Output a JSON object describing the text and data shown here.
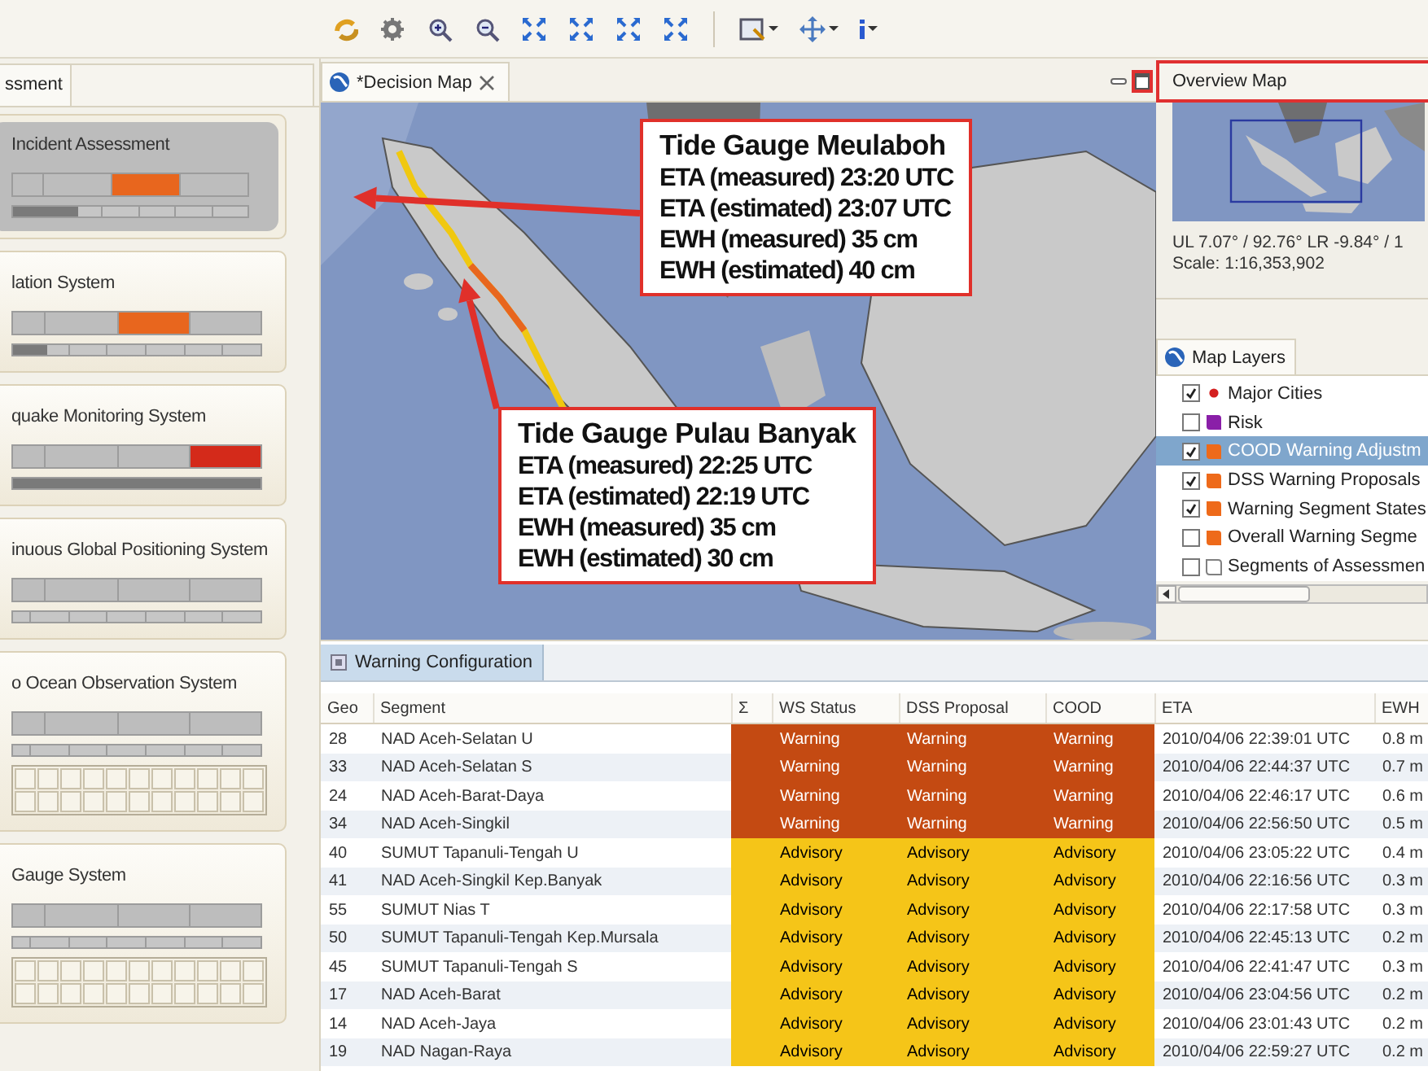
{
  "assessment_panel": {
    "tab": "ssment",
    "systems": [
      {
        "title": "Incident Assessment",
        "selected": true,
        "segments": [
          {
            "color": "#bdbdbd"
          },
          {
            "color": "#bdbdbd"
          },
          {
            "color": "#e8661e"
          },
          {
            "color": "#bdbdbd"
          }
        ],
        "level": 0.28,
        "grid": false
      },
      {
        "title": "lation System",
        "selected": false,
        "segments": [
          {
            "color": "#bdbdbd"
          },
          {
            "color": "#bdbdbd"
          },
          {
            "color": "#e8661e"
          },
          {
            "color": "#bdbdbd"
          }
        ],
        "level": 0.14,
        "grid": false
      },
      {
        "title": "quake Monitoring System",
        "selected": false,
        "segments": [
          {
            "color": "#bdbdbd"
          },
          {
            "color": "#bdbdbd"
          },
          {
            "color": "#bdbdbd"
          },
          {
            "color": "#d42a1a"
          }
        ],
        "level": 1,
        "grid": false
      },
      {
        "title": "inuous Global Positioning System",
        "selected": false,
        "segments": [
          {
            "color": "#bdbdbd"
          },
          {
            "color": "#bdbdbd"
          },
          {
            "color": "#bdbdbd"
          },
          {
            "color": "#bdbdbd"
          }
        ],
        "grid": false
      },
      {
        "title": "o Ocean Observation System",
        "selected": false,
        "segments": [
          {
            "color": "#bdbdbd"
          },
          {
            "color": "#bdbdbd"
          },
          {
            "color": "#bdbdbd"
          },
          {
            "color": "#bdbdbd"
          }
        ],
        "grid": true
      },
      {
        "title": "Gauge System",
        "selected": false,
        "segments": [
          {
            "color": "#bdbdbd"
          },
          {
            "color": "#bdbdbd"
          },
          {
            "color": "#bdbdbd"
          },
          {
            "color": "#bdbdbd"
          }
        ],
        "grid": true
      }
    ]
  },
  "map_view": {
    "tab": "*Decision Map",
    "callouts": [
      {
        "title": "Tide Gauge Meulaboh",
        "lines": [
          "ETA (measured) 23:20 UTC",
          "ETA (estimated) 23:07 UTC",
          "EWH (measured) 35 cm",
          "EWH (estimated) 40 cm"
        ]
      },
      {
        "title": "Tide Gauge Pulau Banyak",
        "lines": [
          "ETA (measured) 22:25 UTC",
          "ETA (estimated) 22:19 UTC",
          "EWH (measured) 35 cm",
          "EWH (estimated) 30 cm"
        ]
      }
    ]
  },
  "overview": {
    "title": "Overview Map",
    "coordinates": "UL 7.07° / 92.76° LR -9.84° / 1",
    "scale": "Scale: 1:16,353,902"
  },
  "layers": {
    "tab": "Map Layers",
    "items": [
      {
        "label": "Major Cities",
        "checked": true,
        "selected": false,
        "kind": "dot",
        "color": "#d42020"
      },
      {
        "label": "Risk",
        "checked": false,
        "selected": false,
        "kind": "fill",
        "color": "#8a1fa8"
      },
      {
        "label": "COOD Warning Adjustm",
        "checked": true,
        "selected": true,
        "kind": "fill",
        "color": "#ee6a1a"
      },
      {
        "label": "DSS Warning Proposals",
        "checked": true,
        "selected": false,
        "kind": "fill",
        "color": "#ee6a1a"
      },
      {
        "label": "Warning Segment States",
        "checked": true,
        "selected": false,
        "kind": "fill",
        "color": "#ee6a1a"
      },
      {
        "label": "Overall Warning Segme",
        "checked": false,
        "selected": false,
        "kind": "fill",
        "color": "#ee6a1a"
      },
      {
        "label": "Segments of Assessmen",
        "checked": false,
        "selected": false,
        "kind": "outline",
        "color": "#808080"
      }
    ]
  },
  "warning_table": {
    "tab": "Warning Configuration",
    "columns": [
      "Geo",
      "Segment",
      "Σ",
      "WS Status",
      "DSS Proposal",
      "COOD",
      "ETA",
      "EWH"
    ],
    "rows": [
      {
        "geo": "28",
        "segment": "NAD Aceh-Selatan U",
        "kind": "warning",
        "ws": "Warning",
        "dss": "Warning",
        "cood": "Warning",
        "eta": "2010/04/06 22:39:01 UTC",
        "ewh": "0.8 m"
      },
      {
        "geo": "33",
        "segment": "NAD Aceh-Selatan S",
        "kind": "warning",
        "ws": "Warning",
        "dss": "Warning",
        "cood": "Warning",
        "eta": "2010/04/06 22:44:37 UTC",
        "ewh": "0.7 m"
      },
      {
        "geo": "24",
        "segment": "NAD Aceh-Barat-Daya",
        "kind": "warning",
        "ws": "Warning",
        "dss": "Warning",
        "cood": "Warning",
        "eta": "2010/04/06 22:46:17 UTC",
        "ewh": "0.6 m"
      },
      {
        "geo": "34",
        "segment": "NAD Aceh-Singkil",
        "kind": "warning",
        "ws": "Warning",
        "dss": "Warning",
        "cood": "Warning",
        "eta": "2010/04/06 22:56:50 UTC",
        "ewh": "0.5 m"
      },
      {
        "geo": "40",
        "segment": "SUMUT Tapanuli-Tengah U",
        "kind": "advisory",
        "ws": "Advisory",
        "dss": "Advisory",
        "cood": "Advisory",
        "eta": "2010/04/06 23:05:22 UTC",
        "ewh": "0.4 m"
      },
      {
        "geo": "41",
        "segment": "NAD Aceh-Singkil Kep.Banyak",
        "kind": "advisory",
        "ws": "Advisory",
        "dss": "Advisory",
        "cood": "Advisory",
        "eta": "2010/04/06 22:16:56 UTC",
        "ewh": "0.3 m"
      },
      {
        "geo": "55",
        "segment": "SUMUT Nias T",
        "kind": "advisory",
        "ws": "Advisory",
        "dss": "Advisory",
        "cood": "Advisory",
        "eta": "2010/04/06 22:17:58 UTC",
        "ewh": "0.3 m"
      },
      {
        "geo": "50",
        "segment": "SUMUT Tapanuli-Tengah Kep.Mursala",
        "kind": "advisory",
        "ws": "Advisory",
        "dss": "Advisory",
        "cood": "Advisory",
        "eta": "2010/04/06 22:45:13 UTC",
        "ewh": "0.2 m"
      },
      {
        "geo": "45",
        "segment": "SUMUT Tapanuli-Tengah S",
        "kind": "advisory",
        "ws": "Advisory",
        "dss": "Advisory",
        "cood": "Advisory",
        "eta": "2010/04/06 22:41:47 UTC",
        "ewh": "0.3 m"
      },
      {
        "geo": "17",
        "segment": "NAD Aceh-Barat",
        "kind": "advisory",
        "ws": "Advisory",
        "dss": "Advisory",
        "cood": "Advisory",
        "eta": "2010/04/06 23:04:56 UTC",
        "ewh": "0.2 m"
      },
      {
        "geo": "14",
        "segment": "NAD Aceh-Jaya",
        "kind": "advisory",
        "ws": "Advisory",
        "dss": "Advisory",
        "cood": "Advisory",
        "eta": "2010/04/06 23:01:43 UTC",
        "ewh": "0.2 m"
      },
      {
        "geo": "19",
        "segment": "NAD Nagan-Raya",
        "kind": "advisory",
        "ws": "Advisory",
        "dss": "Advisory",
        "cood": "Advisory",
        "eta": "2010/04/06 22:59:27 UTC",
        "ewh": "0.2 m"
      }
    ]
  }
}
